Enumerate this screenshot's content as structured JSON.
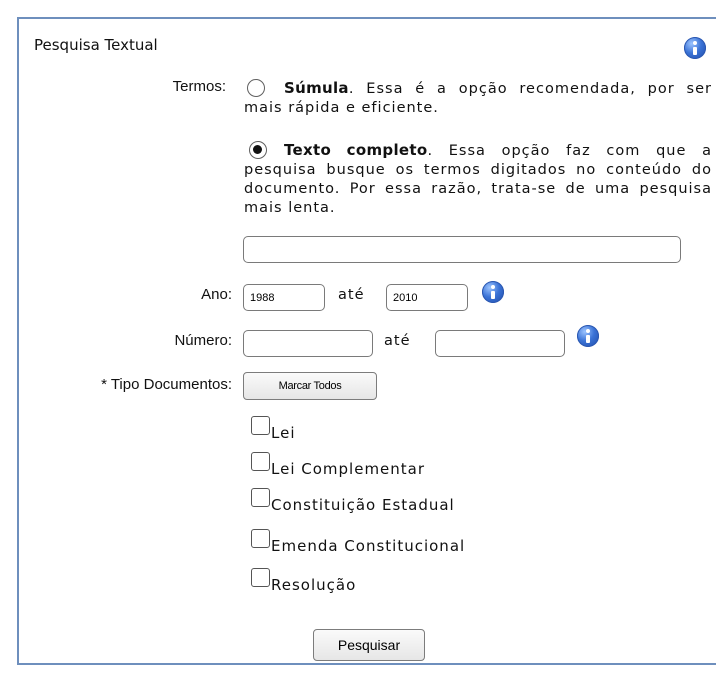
{
  "panel": {
    "title": "Pesquisa Textual"
  },
  "termos": {
    "label": "Termos:",
    "option_sumula": {
      "bold": "Súmula",
      "rest": ". Essa é a opção recomendada, por ser mais rápida e eficiente.",
      "checked": false
    },
    "option_texto": {
      "bold": "Texto completo",
      "rest": ". Essa opção faz com que a pesquisa busque os termos digitados no conteúdo do documento. Por essa razão, trata-se de uma pesquisa mais lenta.",
      "checked": true
    },
    "search_value": ""
  },
  "ano": {
    "label": "Ano:",
    "from": "1988",
    "connector": "até",
    "to": "2010"
  },
  "numero": {
    "label": "Número:",
    "from": "",
    "connector": "até",
    "to": ""
  },
  "tipo": {
    "label": "* Tipo Documentos:",
    "mark_all_label": "Marcar Todos",
    "options": [
      {
        "label": "Lei",
        "checked": false
      },
      {
        "label": "Lei Complementar",
        "checked": false
      },
      {
        "label": "Constituição Estadual",
        "checked": false
      },
      {
        "label": "Emenda Constitucional",
        "checked": false
      },
      {
        "label": "Resolução",
        "checked": false
      }
    ]
  },
  "submit_label": "Pesquisar"
}
